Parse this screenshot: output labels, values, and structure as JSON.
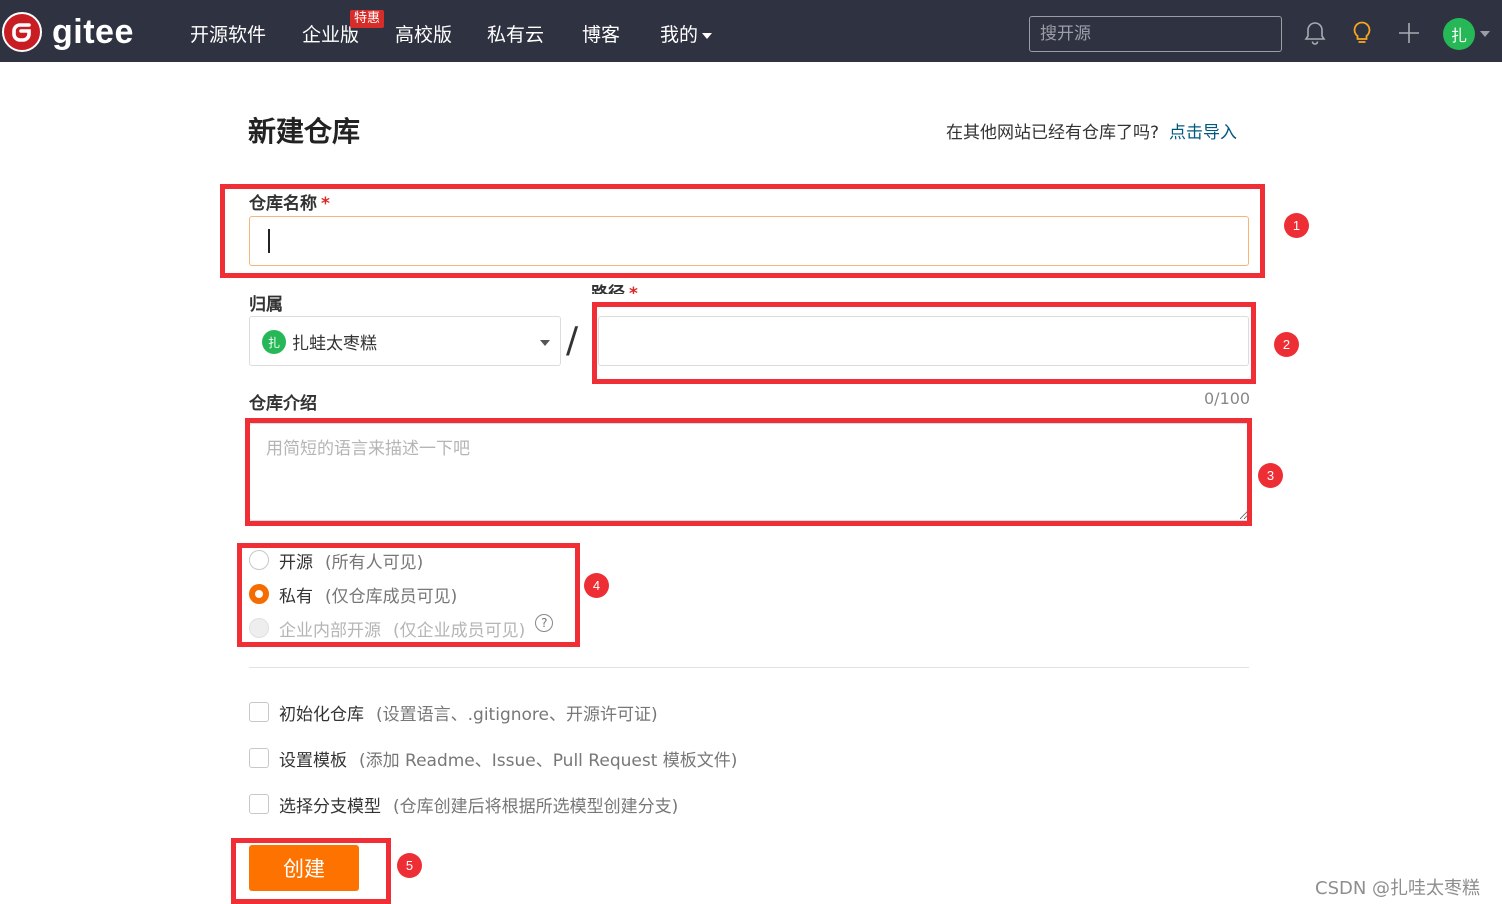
{
  "topbar": {
    "logo_text": "gitee",
    "nav": [
      {
        "label": "开源软件"
      },
      {
        "label": "企业版",
        "badge": "特惠"
      },
      {
        "label": "高校版"
      },
      {
        "label": "私有云"
      },
      {
        "label": "博客"
      },
      {
        "label": "我的",
        "has_dropdown": true
      }
    ],
    "search_placeholder": "搜开源",
    "icons": [
      "bell-icon",
      "lightbulb-icon",
      "plus-icon"
    ],
    "avatar_char": "扎"
  },
  "page": {
    "title": "新建仓库",
    "import_prompt": "在其他网站已经有仓库了吗?",
    "import_link": "点击导入"
  },
  "form": {
    "repo_name": {
      "label": "仓库名称",
      "required_mark": "*",
      "value": ""
    },
    "owner": {
      "label": "归属",
      "avatar_char": "扎",
      "value": "扎蛙太枣糕"
    },
    "separator": "/",
    "path": {
      "label": "路径",
      "required_mark": "*",
      "value": ""
    },
    "description": {
      "label": "仓库介绍",
      "counter": "0/100",
      "placeholder": "用简短的语言来描述一下吧"
    },
    "visibility": [
      {
        "label": "开源",
        "hint": "(所有人可见)",
        "checked": false,
        "disabled": false
      },
      {
        "label": "私有",
        "hint": "(仅仓库成员可见)",
        "checked": true,
        "disabled": false
      },
      {
        "label": "企业内部开源",
        "hint": "(仅企业成员可见)",
        "checked": false,
        "disabled": true,
        "help": "?"
      }
    ],
    "options": [
      {
        "label": "初始化仓库",
        "hint": "(设置语言、.gitignore、开源许可证)",
        "checked": false
      },
      {
        "label": "设置模板",
        "hint": "(添加 Readme、Issue、Pull Request 模板文件)",
        "checked": false
      },
      {
        "label": "选择分支模型",
        "hint": "(仓库创建后将根据所选模型创建分支)",
        "checked": false
      }
    ],
    "submit_label": "创建"
  },
  "annotations": [
    "1",
    "2",
    "3",
    "4",
    "5"
  ],
  "colors": {
    "topbar_bg": "#2f3240",
    "brand_red": "#c71d23",
    "primary_orange": "#fe7300",
    "link_blue": "#005980",
    "annotation_red": "#f02e36",
    "avatar_green": "#26b856"
  },
  "watermark": "CSDN @扎哇太枣糕"
}
